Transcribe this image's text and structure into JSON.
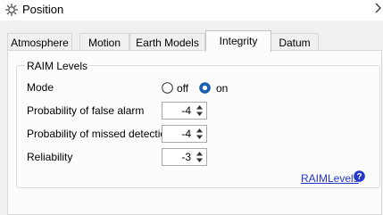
{
  "window": {
    "title": "Position",
    "title_icon": "gear-icon",
    "chevron_icon": "chevron-right-icon"
  },
  "tabs": [
    {
      "label": "Atmosphere",
      "active": false
    },
    {
      "label": "Motion",
      "active": false
    },
    {
      "label": "Earth Models",
      "active": false
    },
    {
      "label": "Integrity",
      "active": true
    },
    {
      "label": "Datum",
      "active": false
    }
  ],
  "group": {
    "title": "RAIM Levels",
    "mode": {
      "label": "Mode",
      "options": [
        "off",
        "on"
      ],
      "selected": "on"
    },
    "fields": [
      {
        "label": "Probability of false alarm",
        "value": "-4"
      },
      {
        "label": "Probability of missed detection",
        "value": "-4"
      },
      {
        "label": "Reliability",
        "value": "-3"
      }
    ]
  },
  "help_link": {
    "label": "RAIMLevels",
    "icon": "help-icon"
  },
  "colors": {
    "accent": "#1a5fb4",
    "link": "#2438c9"
  }
}
